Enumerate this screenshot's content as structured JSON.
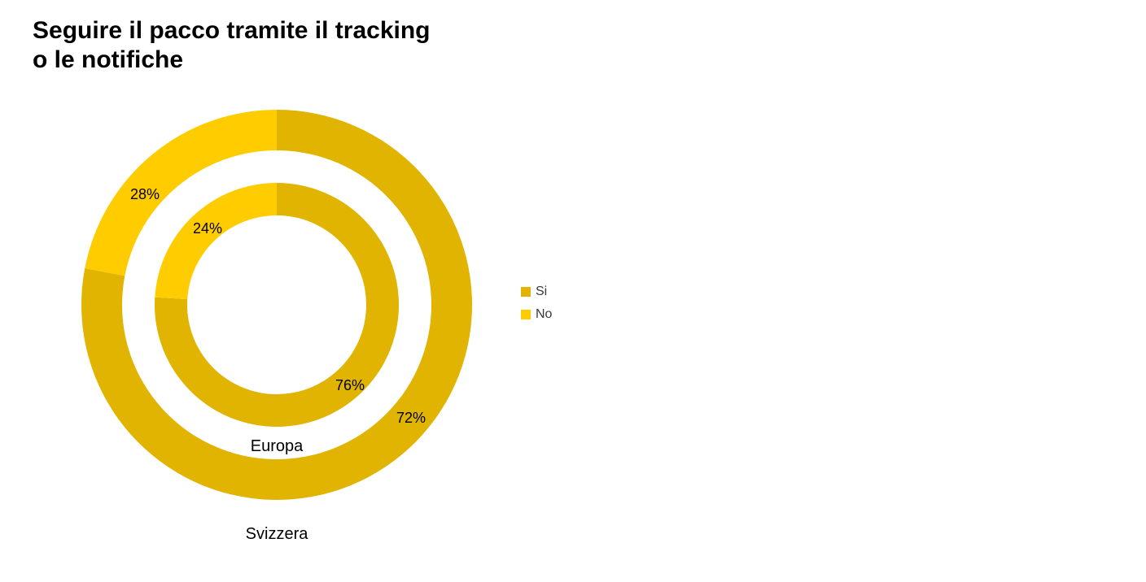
{
  "chart_data": {
    "type": "pie",
    "title": "Seguire il pacco tramite il tracking\no le notifiche",
    "rings": [
      {
        "name": "Svizzera",
        "si": 72,
        "no": 28
      },
      {
        "name": "Europa",
        "si": 76,
        "no": 24
      }
    ],
    "legend": [
      "Si",
      "No"
    ],
    "colors": {
      "si": "#e0b400",
      "no": "#ffcc00"
    }
  },
  "labels": {
    "outer_si": "72%",
    "outer_no": "28%",
    "inner_si": "76%",
    "inner_no": "24%",
    "outer_name": "Svizzera",
    "inner_name": "Europa",
    "legend_si": "Si",
    "legend_no": "No"
  }
}
